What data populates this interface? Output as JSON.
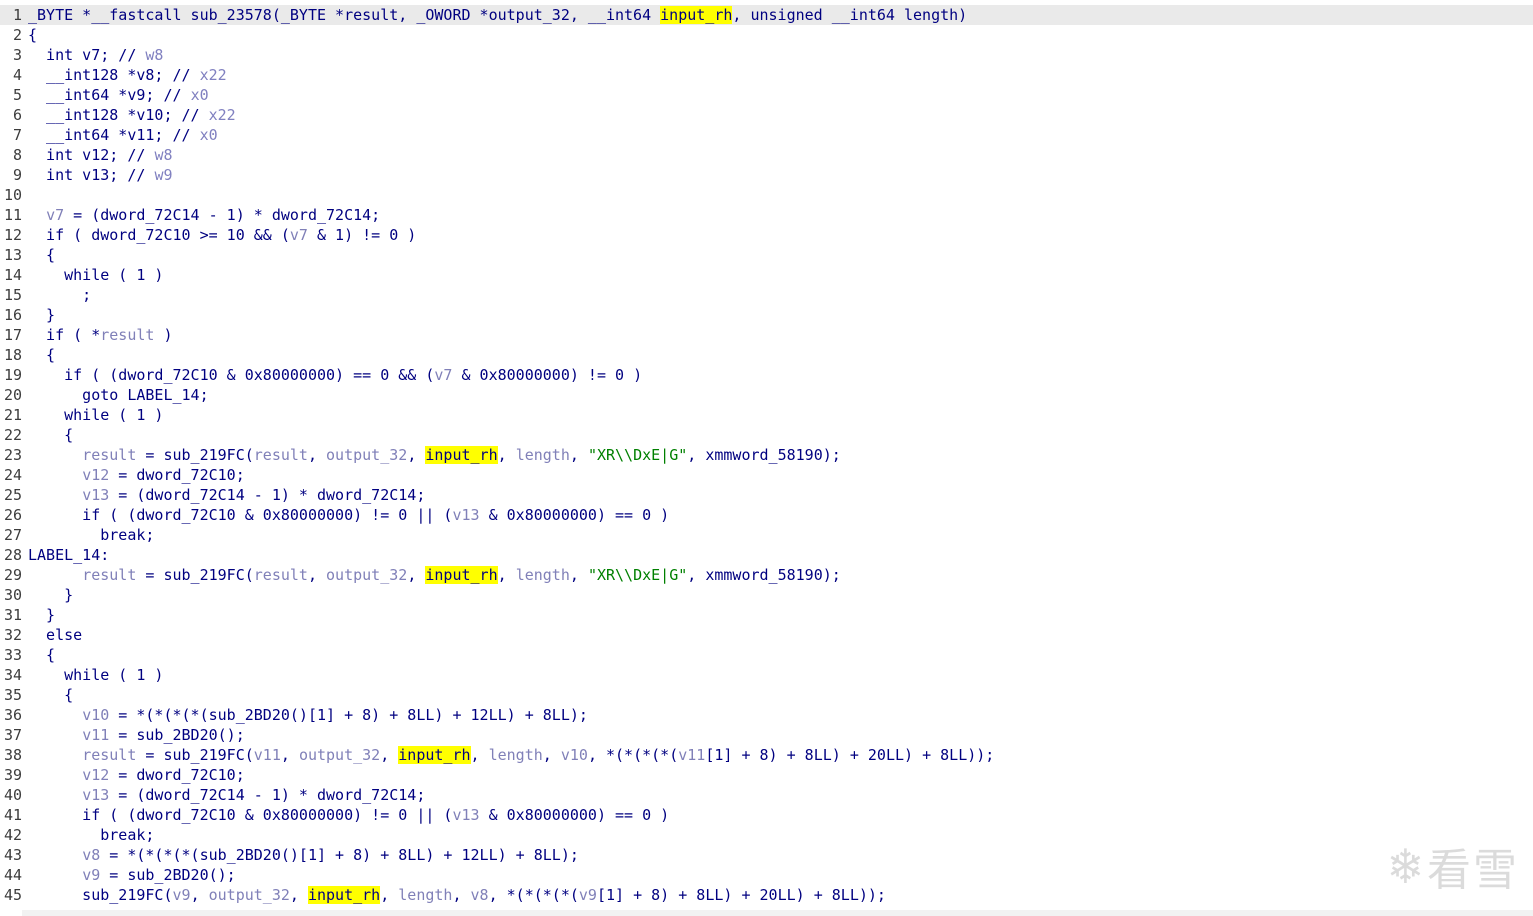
{
  "view": "pseudocode",
  "highlight_term": "input_rh",
  "watermark": {
    "icon": "snowflake-icon",
    "text": "看雪"
  },
  "lines": [
    {
      "n": "1",
      "t": [
        [
          "k",
          "_BYTE *__fastcall sub_23578(_BYTE *result, _OWORD *output_32, __int64 "
        ],
        [
          "h",
          "input_rh"
        ],
        [
          "k",
          ", unsigned __int64 length)"
        ]
      ]
    },
    {
      "n": "2",
      "t": [
        [
          "k",
          "{"
        ]
      ]
    },
    {
      "n": "3",
      "t": [
        [
          "k",
          "  int v7; // "
        ],
        [
          "c",
          "w8"
        ]
      ]
    },
    {
      "n": "4",
      "t": [
        [
          "k",
          "  __int128 *v8; // "
        ],
        [
          "c",
          "x22"
        ]
      ]
    },
    {
      "n": "5",
      "t": [
        [
          "k",
          "  __int64 *v9; // "
        ],
        [
          "c",
          "x0"
        ]
      ]
    },
    {
      "n": "6",
      "t": [
        [
          "k",
          "  __int128 *v10; // "
        ],
        [
          "c",
          "x22"
        ]
      ]
    },
    {
      "n": "7",
      "t": [
        [
          "k",
          "  __int64 *v11; // "
        ],
        [
          "c",
          "x0"
        ]
      ]
    },
    {
      "n": "8",
      "t": [
        [
          "k",
          "  int v12; // "
        ],
        [
          "c",
          "w8"
        ]
      ]
    },
    {
      "n": "9",
      "t": [
        [
          "k",
          "  int v13; // "
        ],
        [
          "c",
          "w9"
        ]
      ]
    },
    {
      "n": "10",
      "t": [
        [
          "k",
          ""
        ]
      ]
    },
    {
      "n": "11",
      "t": [
        [
          "k",
          "  "
        ],
        [
          "v",
          "v7"
        ],
        [
          "k",
          " = (dword_72C14 - 1) * dword_72C14;"
        ]
      ]
    },
    {
      "n": "12",
      "t": [
        [
          "k",
          "  if ( dword_72C10 >= 10 && ("
        ],
        [
          "v",
          "v7"
        ],
        [
          "k",
          " & 1) != 0 )"
        ]
      ]
    },
    {
      "n": "13",
      "t": [
        [
          "k",
          "  {"
        ]
      ]
    },
    {
      "n": "14",
      "t": [
        [
          "k",
          "    while ( 1 )"
        ]
      ]
    },
    {
      "n": "15",
      "t": [
        [
          "k",
          "      ;"
        ]
      ]
    },
    {
      "n": "16",
      "t": [
        [
          "k",
          "  }"
        ]
      ]
    },
    {
      "n": "17",
      "t": [
        [
          "k",
          "  if ( *"
        ],
        [
          "v",
          "result"
        ],
        [
          "k",
          " )"
        ]
      ]
    },
    {
      "n": "18",
      "t": [
        [
          "k",
          "  {"
        ]
      ]
    },
    {
      "n": "19",
      "t": [
        [
          "k",
          "    if ( (dword_72C10 & 0x80000000) == 0 && ("
        ],
        [
          "v",
          "v7"
        ],
        [
          "k",
          " & 0x80000000) != 0 )"
        ]
      ]
    },
    {
      "n": "20",
      "t": [
        [
          "k",
          "      goto LABEL_14;"
        ]
      ]
    },
    {
      "n": "21",
      "t": [
        [
          "k",
          "    while ( 1 )"
        ]
      ]
    },
    {
      "n": "22",
      "t": [
        [
          "k",
          "    {"
        ]
      ]
    },
    {
      "n": "23",
      "t": [
        [
          "k",
          "      "
        ],
        [
          "v",
          "result"
        ],
        [
          "k",
          " = sub_219FC("
        ],
        [
          "v",
          "result"
        ],
        [
          "k",
          ", "
        ],
        [
          "v",
          "output_32"
        ],
        [
          "k",
          ", "
        ],
        [
          "h",
          "input_rh"
        ],
        [
          "k",
          ", "
        ],
        [
          "v",
          "length"
        ],
        [
          "k",
          ", "
        ],
        [
          "s",
          "\"XR\\\\DxE|G\""
        ],
        [
          "k",
          ", xmmword_58190);"
        ]
      ]
    },
    {
      "n": "24",
      "t": [
        [
          "k",
          "      "
        ],
        [
          "v",
          "v12"
        ],
        [
          "k",
          " = dword_72C10;"
        ]
      ]
    },
    {
      "n": "25",
      "t": [
        [
          "k",
          "      "
        ],
        [
          "v",
          "v13"
        ],
        [
          "k",
          " = (dword_72C14 - 1) * dword_72C14;"
        ]
      ]
    },
    {
      "n": "26",
      "t": [
        [
          "k",
          "      if ( (dword_72C10 & 0x80000000) != 0 || ("
        ],
        [
          "v",
          "v13"
        ],
        [
          "k",
          " & 0x80000000) == 0 )"
        ]
      ]
    },
    {
      "n": "27",
      "t": [
        [
          "k",
          "        break;"
        ]
      ]
    },
    {
      "n": "28",
      "t": [
        [
          "k",
          "LABEL_14:"
        ]
      ]
    },
    {
      "n": "29",
      "t": [
        [
          "k",
          "      "
        ],
        [
          "v",
          "result"
        ],
        [
          "k",
          " = sub_219FC("
        ],
        [
          "v",
          "result"
        ],
        [
          "k",
          ", "
        ],
        [
          "v",
          "output_32"
        ],
        [
          "k",
          ", "
        ],
        [
          "h",
          "input_rh"
        ],
        [
          "k",
          ", "
        ],
        [
          "v",
          "length"
        ],
        [
          "k",
          ", "
        ],
        [
          "s",
          "\"XR\\\\DxE|G\""
        ],
        [
          "k",
          ", xmmword_58190);"
        ]
      ]
    },
    {
      "n": "30",
      "t": [
        [
          "k",
          "    }"
        ]
      ]
    },
    {
      "n": "31",
      "t": [
        [
          "k",
          "  }"
        ]
      ]
    },
    {
      "n": "32",
      "t": [
        [
          "k",
          "  else"
        ]
      ]
    },
    {
      "n": "33",
      "t": [
        [
          "k",
          "  {"
        ]
      ]
    },
    {
      "n": "34",
      "t": [
        [
          "k",
          "    while ( 1 )"
        ]
      ]
    },
    {
      "n": "35",
      "t": [
        [
          "k",
          "    {"
        ]
      ]
    },
    {
      "n": "36",
      "t": [
        [
          "k",
          "      "
        ],
        [
          "v",
          "v10"
        ],
        [
          "k",
          " = *(*(*(*(sub_2BD20()[1] + 8) + 8LL) + 12LL) + 8LL);"
        ]
      ]
    },
    {
      "n": "37",
      "t": [
        [
          "k",
          "      "
        ],
        [
          "v",
          "v11"
        ],
        [
          "k",
          " = sub_2BD20();"
        ]
      ]
    },
    {
      "n": "38",
      "t": [
        [
          "k",
          "      "
        ],
        [
          "v",
          "result"
        ],
        [
          "k",
          " = sub_219FC("
        ],
        [
          "v",
          "v11"
        ],
        [
          "k",
          ", "
        ],
        [
          "v",
          "output_32"
        ],
        [
          "k",
          ", "
        ],
        [
          "h",
          "input_rh"
        ],
        [
          "k",
          ", "
        ],
        [
          "v",
          "length"
        ],
        [
          "k",
          ", "
        ],
        [
          "v",
          "v10"
        ],
        [
          "k",
          ", *(*(*(*("
        ],
        [
          "v",
          "v11"
        ],
        [
          "k",
          "[1] + 8) + 8LL) + 20LL) + 8LL));"
        ]
      ]
    },
    {
      "n": "39",
      "t": [
        [
          "k",
          "      "
        ],
        [
          "v",
          "v12"
        ],
        [
          "k",
          " = dword_72C10;"
        ]
      ]
    },
    {
      "n": "40",
      "t": [
        [
          "k",
          "      "
        ],
        [
          "v",
          "v13"
        ],
        [
          "k",
          " = (dword_72C14 - 1) * dword_72C14;"
        ]
      ]
    },
    {
      "n": "41",
      "t": [
        [
          "k",
          "      if ( (dword_72C10 & 0x80000000) != 0 || ("
        ],
        [
          "v",
          "v13"
        ],
        [
          "k",
          " & 0x80000000) == 0 )"
        ]
      ]
    },
    {
      "n": "42",
      "t": [
        [
          "k",
          "        break;"
        ]
      ]
    },
    {
      "n": "43",
      "t": [
        [
          "k",
          "      "
        ],
        [
          "v",
          "v8"
        ],
        [
          "k",
          " = *(*(*(*(sub_2BD20()[1] + 8) + 8LL) + 12LL) + 8LL);"
        ]
      ]
    },
    {
      "n": "44",
      "t": [
        [
          "k",
          "      "
        ],
        [
          "v",
          "v9"
        ],
        [
          "k",
          " = sub_2BD20();"
        ]
      ]
    },
    {
      "n": "45",
      "t": [
        [
          "k",
          "      sub_219FC("
        ],
        [
          "v",
          "v9"
        ],
        [
          "k",
          ", "
        ],
        [
          "v",
          "output_32"
        ],
        [
          "k",
          ", "
        ],
        [
          "h",
          "input_rh"
        ],
        [
          "k",
          ", "
        ],
        [
          "v",
          "length"
        ],
        [
          "k",
          ", "
        ],
        [
          "v",
          "v8"
        ],
        [
          "k",
          ", *(*(*(*("
        ],
        [
          "v",
          "v9"
        ],
        [
          "k",
          "[1] + 8) + 8LL) + 20LL) + 8LL));"
        ]
      ]
    }
  ]
}
